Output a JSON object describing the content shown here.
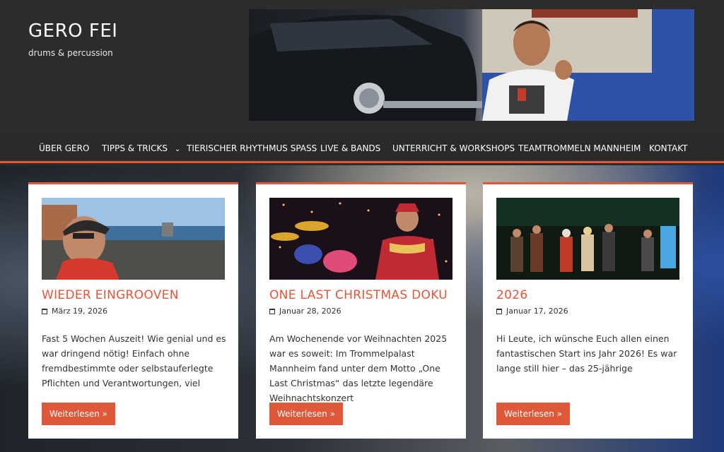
{
  "site": {
    "title": "GERO FEI",
    "description": "drums & percussion"
  },
  "nav": {
    "items": [
      {
        "label": "ÜBER GERO"
      },
      {
        "label": "TIPPS & TRICKS",
        "has_dropdown": true
      },
      {
        "label": "TIERISCHER RHYTHMUS SPASS"
      },
      {
        "label": "LIVE & BANDS"
      },
      {
        "label": "UNTERRICHT & WORKSHOPS"
      },
      {
        "label": "TEAMTROMMELN MANNHEIM"
      },
      {
        "label": "KONTAKT"
      }
    ]
  },
  "posts": [
    {
      "title": "WIEDER EINGROOVEN",
      "date": "März 19, 2026",
      "excerpt": "Fast 5 Wochen Auszeit! Wie genial und es war dringend nötig! Einfach ohne fremdbestimmte oder selbstauferlegte Pflichten und Verantwortungen, viel",
      "button": "Weiterlesen »"
    },
    {
      "title": "ONE LAST CHRISTMAS DOKU",
      "date": "Januar 28, 2026",
      "excerpt": "Am Wochenende vor Weihnachten 2025 war es soweit: Im Trommelpalast Mannheim fand unter dem Motto „One Last Christmas“ das letzte legendäre Weihnachtskonzert",
      "button": "Weiterlesen »"
    },
    {
      "title": "2026",
      "date": "Januar 17, 2026",
      "excerpt": "Hi Leute, ich wünsche Euch allen einen fantastischen Start ins Jahr 2026! Es war lange still hier – das 25-jährige",
      "button": "Weiterlesen »"
    }
  ],
  "colors": {
    "accent": "#e1573a",
    "header_bg": "#2c2c2c",
    "card_bg": "#ffffff"
  }
}
